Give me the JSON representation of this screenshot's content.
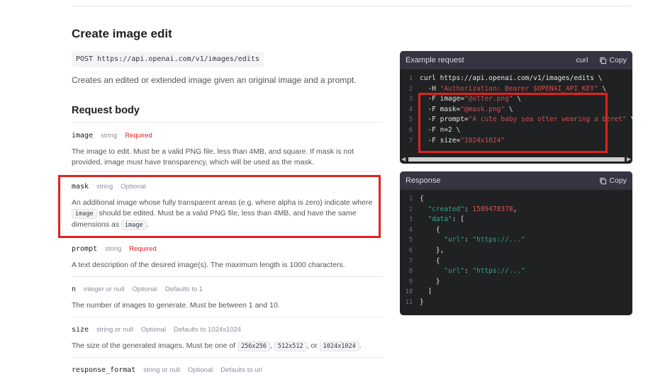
{
  "page": {
    "title": "Create image edit",
    "endpoint": "POST https://api.openai.com/v1/images/edits",
    "description": "Creates an edited or extended image given an original image and a prompt.",
    "section": "Request body"
  },
  "params": {
    "image": {
      "name": "image",
      "type": "string",
      "req": "Required",
      "text": "The image to edit. Must be a valid PNG file, less than 4MB, and square. If mask is not provided, image must have transparency, which will be used as the mask."
    },
    "mask": {
      "name": "mask",
      "type": "string",
      "opt": "Optional",
      "text_a": "An additional image whose fully transparent areas (e.g. where alpha is zero) indicate where",
      "code_a": "image",
      "text_b": "should be edited. Must be a valid PNG file, less than 4MB, and have the same dimensions as",
      "code_b": "image",
      "text_c": "."
    },
    "prompt": {
      "name": "prompt",
      "type": "string",
      "req": "Required",
      "text": "A text description of the desired image(s). The maximum length is 1000 characters."
    },
    "n": {
      "name": "n",
      "type": "integer or null",
      "opt": "Optional",
      "def": "Defaults to 1",
      "text": "The number of images to generate. Must be between 1 and 10."
    },
    "size": {
      "name": "size",
      "type": "string or null",
      "opt": "Optional",
      "def": "Defaults to 1024x1024",
      "text_a": "The size of the generated images. Must be one of",
      "c1": "256x256",
      "sep1": ",",
      "c2": "512x512",
      "sep2": ", or",
      "c3": "1024x1024",
      "text_b": "."
    },
    "response_format": {
      "name": "response_format",
      "type": "string or null",
      "opt": "Optional",
      "def": "Defaults to url"
    }
  },
  "example": {
    "title": "Example request",
    "lang": "curl",
    "copy": "Copy",
    "lines": [
      {
        "n": "1",
        "parts": [
          [
            "curl https://api.openai.com/v1/images/edits \\",
            ""
          ]
        ]
      },
      {
        "n": "2",
        "parts": [
          [
            "  -H ",
            ""
          ],
          [
            "\"Authorization: Bearer $OPENAI_API_KEY\"",
            "str"
          ],
          [
            " \\",
            ""
          ]
        ]
      },
      {
        "n": "3",
        "parts": [
          [
            "  -F image=",
            ""
          ],
          [
            "\"@otter.png\"",
            "str"
          ],
          [
            " \\",
            ""
          ]
        ]
      },
      {
        "n": "4",
        "parts": [
          [
            "  -F mask=",
            ""
          ],
          [
            "\"@mask.png\"",
            "str"
          ],
          [
            " \\",
            ""
          ]
        ]
      },
      {
        "n": "5",
        "parts": [
          [
            "  -F prompt=",
            ""
          ],
          [
            "\"A cute baby sea otter wearing a beret\"",
            "str"
          ],
          [
            " \\",
            ""
          ]
        ]
      },
      {
        "n": "6",
        "parts": [
          [
            "  -F n=2 \\",
            ""
          ]
        ]
      },
      {
        "n": "7",
        "parts": [
          [
            "  -F size=",
            ""
          ],
          [
            "\"1024x1024\"",
            "str"
          ]
        ]
      }
    ]
  },
  "response": {
    "title": "Response",
    "copy": "Copy",
    "lines": [
      {
        "n": "1",
        "parts": [
          [
            "{",
            ""
          ]
        ]
      },
      {
        "n": "2",
        "parts": [
          [
            "  ",
            ""
          ],
          [
            "\"created\"",
            "green"
          ],
          [
            ": ",
            ""
          ],
          [
            "1589478378",
            "num"
          ],
          [
            ",",
            ""
          ]
        ]
      },
      {
        "n": "3",
        "parts": [
          [
            "  ",
            ""
          ],
          [
            "\"data\"",
            "green"
          ],
          [
            ": [",
            ""
          ]
        ]
      },
      {
        "n": "4",
        "parts": [
          [
            "    {",
            ""
          ]
        ]
      },
      {
        "n": "5",
        "parts": [
          [
            "      ",
            ""
          ],
          [
            "\"url\"",
            "green"
          ],
          [
            ": ",
            ""
          ],
          [
            "\"https://...\"",
            "green"
          ]
        ]
      },
      {
        "n": "6",
        "parts": [
          [
            "    },",
            ""
          ]
        ]
      },
      {
        "n": "7",
        "parts": [
          [
            "    {",
            ""
          ]
        ]
      },
      {
        "n": "8",
        "parts": [
          [
            "      ",
            ""
          ],
          [
            "\"url\"",
            "green"
          ],
          [
            ": ",
            ""
          ],
          [
            "\"https://...\"",
            "green"
          ]
        ]
      },
      {
        "n": "9",
        "parts": [
          [
            "    }",
            ""
          ]
        ]
      },
      {
        "n": "10",
        "parts": [
          [
            "  ]",
            ""
          ]
        ]
      },
      {
        "n": "11",
        "parts": [
          [
            "}",
            ""
          ]
        ]
      }
    ]
  },
  "colors": {
    "highlight": "#e0231e",
    "required": "#e0231e",
    "panel_bg": "#202123"
  }
}
